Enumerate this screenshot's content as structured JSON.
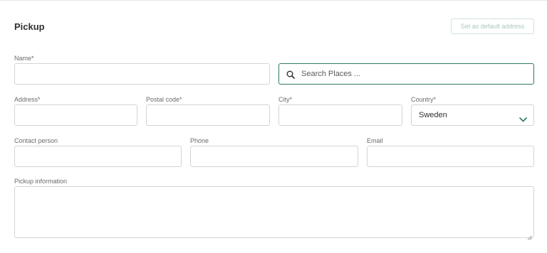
{
  "section": {
    "title": "Pickup",
    "default_button": "Set as default address"
  },
  "fields": {
    "name": {
      "label": "Name*"
    },
    "search": {
      "placeholder": "Search Places ..."
    },
    "address": {
      "label": "Address*"
    },
    "postal_code": {
      "label": "Postal code*"
    },
    "city": {
      "label": "City*"
    },
    "country": {
      "label": "Country*",
      "value": "Sweden"
    },
    "contact_person": {
      "label": "Contact person"
    },
    "phone": {
      "label": "Phone"
    },
    "email": {
      "label": "Email"
    },
    "pickup_information": {
      "label": "Pickup information"
    }
  },
  "colors": {
    "accent": "#2d7a5f",
    "border": "#d4d4d4",
    "disabled_button_text": "#a9c8bb"
  },
  "icons": [
    "search-icon",
    "chevron-down-icon",
    "resize-handle-icon"
  ]
}
